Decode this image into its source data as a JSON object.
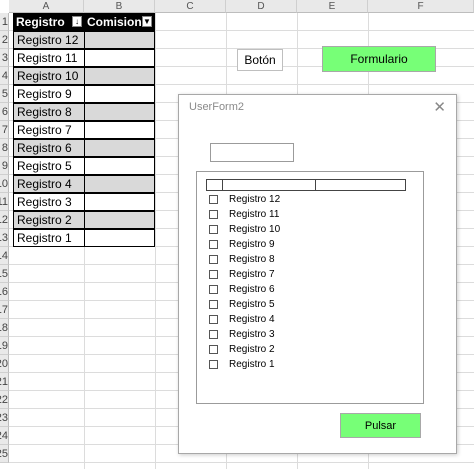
{
  "sheet": {
    "columns": [
      "A",
      "B",
      "C",
      "D",
      "E",
      "F"
    ],
    "row_numbers": [
      "1",
      "2",
      "3",
      "4",
      "5",
      "6",
      "7",
      "8",
      "9",
      "10",
      "11",
      "12",
      "13",
      "14",
      "15",
      "16",
      "17",
      "18",
      "19",
      "20",
      "21",
      "22",
      "23",
      "24",
      "25"
    ],
    "table": {
      "headers": [
        "Registro",
        "Comision"
      ],
      "rows": [
        "Registro 12",
        "Registro 11",
        "Registro 10",
        "Registro 9",
        "Registro 8",
        "Registro 7",
        "Registro 6",
        "Registro 5",
        "Registro 4",
        "Registro 3",
        "Registro 2",
        "Registro 1"
      ]
    },
    "boton_label": "Botón",
    "formulario_label": "Formulario"
  },
  "userform": {
    "title": "UserForm2",
    "close_glyph": "✕",
    "textbox_value": "",
    "listbox_items": [
      "Registro 12",
      "Registro 11",
      "Registro 10",
      "Registro 9",
      "Registro 8",
      "Registro 7",
      "Registro 6",
      "Registro 5",
      "Registro 4",
      "Registro 3",
      "Registro 2",
      "Registro 1"
    ],
    "button_label": "Pulsar"
  },
  "colors": {
    "header_fill": "#000000",
    "band_fill": "#d9d9d9",
    "green_button": "#77ff77",
    "gridline": "#dcdcdc"
  }
}
